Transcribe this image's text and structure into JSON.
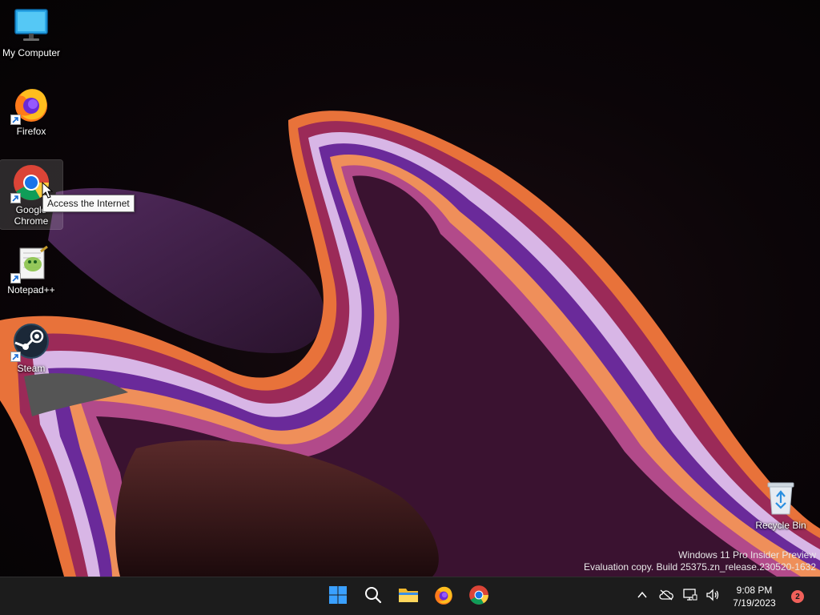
{
  "desktop": {
    "icons": [
      {
        "label": "My Computer",
        "icon": "monitor-icon",
        "shortcut": false
      },
      {
        "label": "Firefox",
        "icon": "firefox-icon",
        "shortcut": true
      },
      {
        "label": "Google Chrome",
        "icon": "chrome-icon",
        "shortcut": true,
        "selected": true
      },
      {
        "label": "Notepad++",
        "icon": "notepadpp-icon",
        "shortcut": true
      },
      {
        "label": "Steam",
        "icon": "steam-icon",
        "shortcut": true
      }
    ],
    "recycle_bin": {
      "label": "Recycle Bin",
      "icon": "recycle-bin-icon"
    },
    "tooltip": "Access the Internet"
  },
  "watermark": {
    "line1": "Windows 11 Pro Insider Preview",
    "line2": "Evaluation copy. Build 25375.zn_release.230520-1632"
  },
  "taskbar": {
    "pinned": [
      {
        "name": "start",
        "icon": "windows-start-icon"
      },
      {
        "name": "search",
        "icon": "search-icon"
      },
      {
        "name": "file-explorer",
        "icon": "folder-icon"
      },
      {
        "name": "firefox",
        "icon": "firefox-icon"
      },
      {
        "name": "chrome",
        "icon": "chrome-icon"
      }
    ],
    "tray": {
      "icons": [
        "chevron-up-icon",
        "cloud-offline-icon",
        "network-icon",
        "volume-icon"
      ],
      "time": "9:08 PM",
      "date": "7/19/2023",
      "notification_count": "2"
    }
  },
  "colors": {
    "taskbar_bg": "#1c1c1c",
    "accent_blue": "#0078d4",
    "badge": "#f0605a"
  }
}
